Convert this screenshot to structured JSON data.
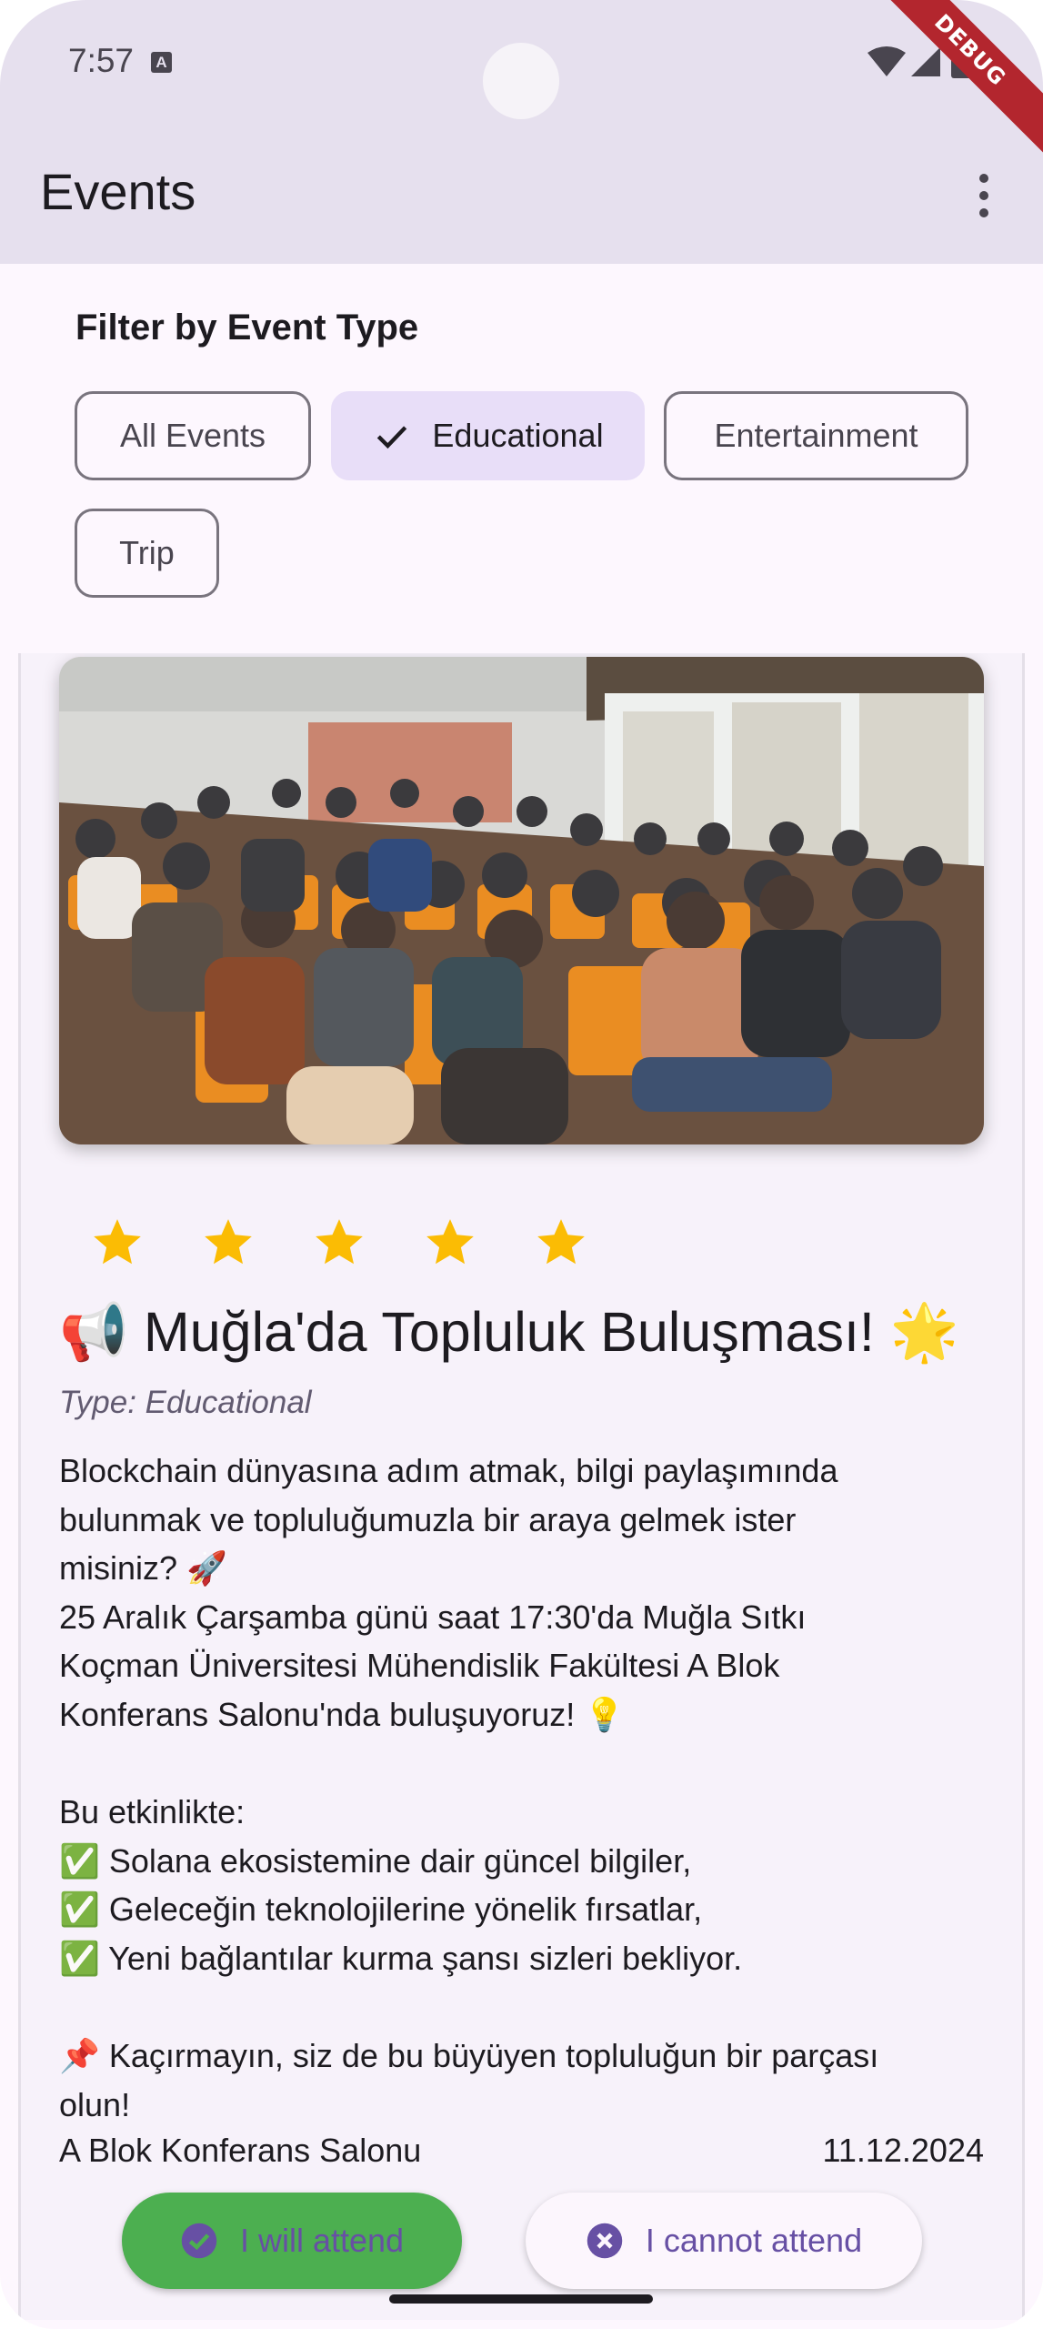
{
  "status_bar": {
    "time": "7:57",
    "notification_glyph": "A",
    "debug_banner": "DEBUG"
  },
  "app_bar": {
    "title": "Events",
    "menu_icon": "more-vert-icon"
  },
  "filter": {
    "heading": "Filter by Event Type",
    "chips": [
      {
        "label": "All Events",
        "selected": false
      },
      {
        "label": "Educational",
        "selected": true
      },
      {
        "label": "Entertainment",
        "selected": false
      },
      {
        "label": "Trip",
        "selected": false
      }
    ]
  },
  "event": {
    "rating": 5,
    "rating_max": 5,
    "title": "📢 Muğla'da Topluluk Buluşması! 🌟",
    "type": "Type: Educational",
    "description": "Blockchain dünyasına adım atmak, bilgi paylaşımında\nbulunmak ve topluluğumuzla bir araya gelmek ister\nmisiniz? 🚀\n25 Aralık Çarşamba günü saat 17:30'da Muğla Sıtkı\nKoçman Üniversitesi Mühendislik Fakültesi A Blok\nKonferans Salonu'nda buluşuyoruz! 💡\n\nBu etkinlikte:\n✅ Solana ekosistemine dair güncel bilgiler,\n✅ Geleceğin teknolojilerine yönelik fırsatlar,\n✅ Yeni bağlantılar kurma şansı sizleri bekliyor.\n\n📌 Kaçırmayın, siz de bu büyüyen topluluğun bir parçası\nolun!",
    "location": "A Blok Konferans Salonu",
    "date": "11.12.2024"
  },
  "actions": {
    "attend_label": "I will attend",
    "cannot_label": "I cannot attend"
  },
  "colors": {
    "primary": "#6750a4",
    "attend_bg": "#4caf50",
    "star": "#fbbc04",
    "app_bar_bg": "#e6e0ee"
  }
}
